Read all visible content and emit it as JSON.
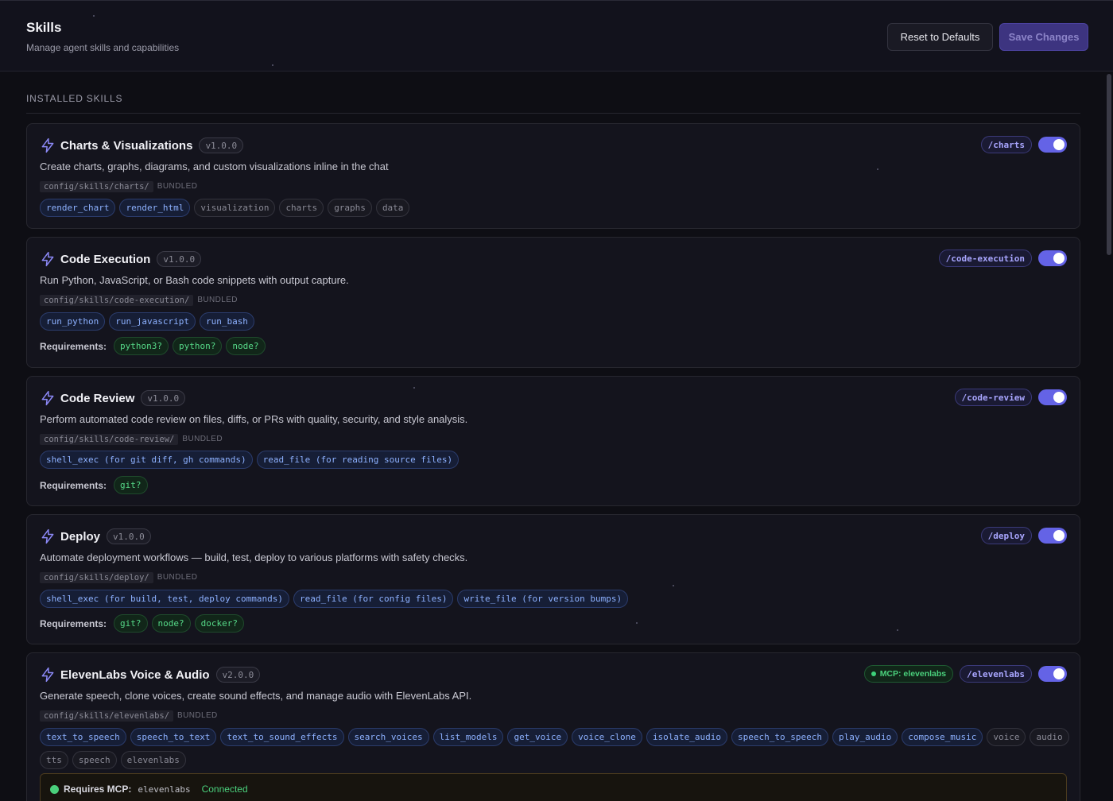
{
  "header": {
    "title": "Skills",
    "subtitle": "Manage agent skills and capabilities",
    "reset_label": "Reset to Defaults",
    "save_label": "Save Changes"
  },
  "section": {
    "label": "INSTALLED SKILLS"
  },
  "requirements_label": "Requirements:",
  "bundled_label": "BUNDLED",
  "accent_color": "#6463e6",
  "skills": [
    {
      "name": "Charts & Visualizations",
      "version": "v1.0.0",
      "description": "Create charts, graphs, diagrams, and custom visualizations inline in the chat",
      "path": "config/skills/charts/",
      "command": "/charts",
      "enabled": true,
      "tools": [
        "render_chart",
        "render_html"
      ],
      "tags": [
        "visualization",
        "charts",
        "graphs",
        "data"
      ],
      "requirements": []
    },
    {
      "name": "Code Execution",
      "version": "v1.0.0",
      "description": "Run Python, JavaScript, or Bash code snippets with output capture.",
      "path": "config/skills/code-execution/",
      "command": "/code-execution",
      "enabled": true,
      "tools": [
        "run_python",
        "run_javascript",
        "run_bash"
      ],
      "tags": [],
      "requirements": [
        "python3?",
        "python?",
        "node?"
      ]
    },
    {
      "name": "Code Review",
      "version": "v1.0.0",
      "description": "Perform automated code review on files, diffs, or PRs with quality, security, and style analysis.",
      "path": "config/skills/code-review/",
      "command": "/code-review",
      "enabled": true,
      "tools": [
        "shell_exec (for git diff, gh commands)",
        "read_file (for reading source files)"
      ],
      "tags": [],
      "requirements": [
        "git?"
      ]
    },
    {
      "name": "Deploy",
      "version": "v1.0.0",
      "description": "Automate deployment workflows — build, test, deploy to various platforms with safety checks.",
      "path": "config/skills/deploy/",
      "command": "/deploy",
      "enabled": true,
      "tools": [
        "shell_exec (for build, test, deploy commands)",
        "read_file (for config files)",
        "write_file (for version bumps)"
      ],
      "tags": [],
      "requirements": [
        "git?",
        "node?",
        "docker?"
      ]
    },
    {
      "name": "ElevenLabs Voice & Audio",
      "version": "v2.0.0",
      "description": "Generate speech, clone voices, create sound effects, and manage audio with ElevenLabs API.",
      "path": "config/skills/elevenlabs/",
      "command": "/elevenlabs",
      "enabled": true,
      "mcp_badge": "MCP: elevenlabs",
      "tools": [
        "text_to_speech",
        "speech_to_text",
        "text_to_sound_effects",
        "search_voices",
        "list_models",
        "get_voice",
        "voice_clone",
        "isolate_audio",
        "speech_to_speech",
        "play_audio",
        "compose_music"
      ],
      "tags": [
        "voice",
        "audio",
        "tts",
        "speech",
        "elevenlabs"
      ],
      "requirements": [],
      "mcp_requirement": {
        "label": "Requires MCP:",
        "server": "elevenlabs",
        "status": "Connected"
      }
    }
  ]
}
